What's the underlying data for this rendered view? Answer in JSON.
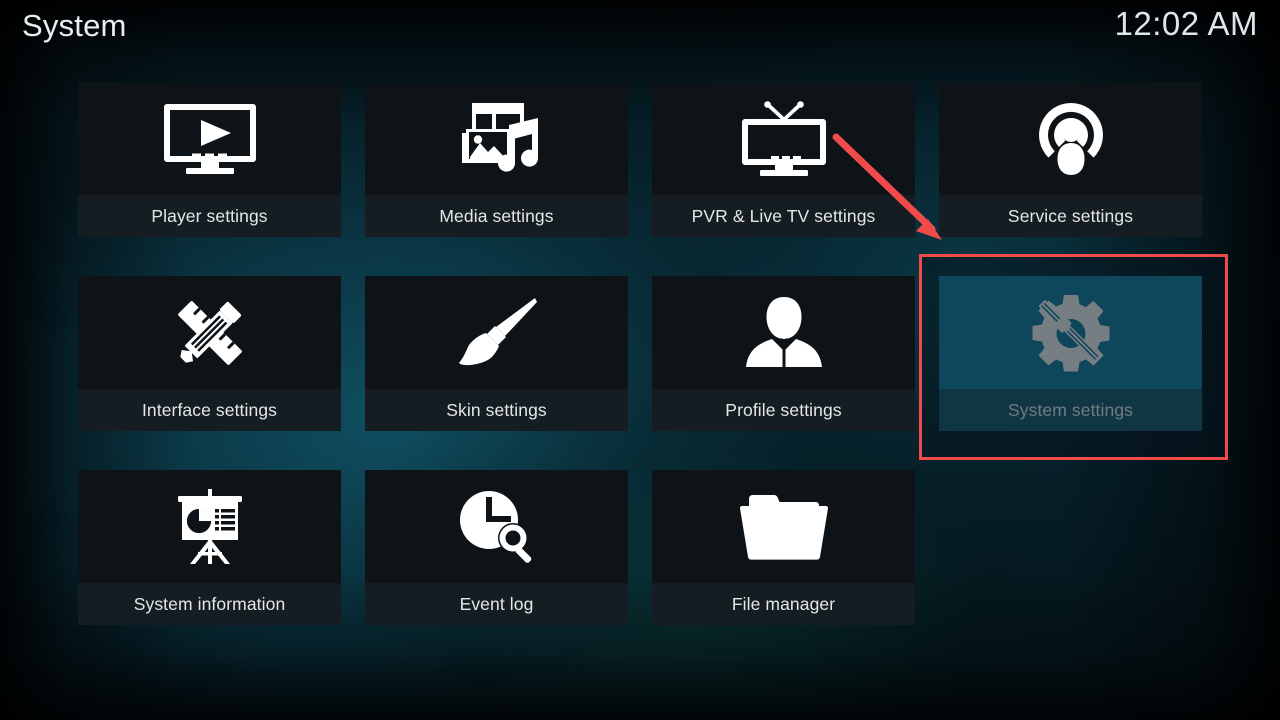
{
  "window": {
    "app": "Kodi",
    "screen_kind": "settings-grid"
  },
  "header": {
    "title": "System",
    "clock": "12:02 AM"
  },
  "colors": {
    "background_teal": "#0a3a48",
    "tile_background": "#0d1418",
    "tile_label_background": "#151d22",
    "focus_icon_background": "#1786a9",
    "focus_label_background": "#1b6074",
    "text": "#e2e8ea",
    "annotation_red": "#f04a4a"
  },
  "grid": {
    "columns": 4,
    "rows": 3,
    "tiles": [
      {
        "id": "player-settings",
        "label": "Player settings",
        "icon": "monitor-play-icon",
        "focused": false
      },
      {
        "id": "media-settings",
        "label": "Media settings",
        "icon": "film-photo-music-icon",
        "focused": false
      },
      {
        "id": "pvr-live-tv-settings",
        "label": "PVR & Live TV settings",
        "icon": "tv-antenna-icon",
        "focused": false
      },
      {
        "id": "service-settings",
        "label": "Service settings",
        "icon": "person-broadcast-icon",
        "focused": false
      },
      {
        "id": "interface-settings",
        "label": "Interface settings",
        "icon": "pencil-ruler-icon",
        "focused": false
      },
      {
        "id": "skin-settings",
        "label": "Skin settings",
        "icon": "paintbrush-icon",
        "focused": false
      },
      {
        "id": "profile-settings",
        "label": "Profile settings",
        "icon": "person-bust-icon",
        "focused": false
      },
      {
        "id": "system-settings",
        "label": "System settings",
        "icon": "gear-screwdriver-icon",
        "focused": true
      },
      {
        "id": "system-information",
        "label": "System information",
        "icon": "presentation-chart-icon",
        "focused": false
      },
      {
        "id": "event-log",
        "label": "Event log",
        "icon": "clock-magnifier-icon",
        "focused": false
      },
      {
        "id": "file-manager",
        "label": "File manager",
        "icon": "folder-icon",
        "focused": false
      }
    ]
  },
  "annotations": {
    "highlight_box": {
      "target": "system-settings",
      "color": "#f04a4a",
      "shape": "rectangle"
    },
    "arrow": {
      "points_to": "system-settings",
      "color": "#f04a4a",
      "direction": "down-right"
    }
  }
}
